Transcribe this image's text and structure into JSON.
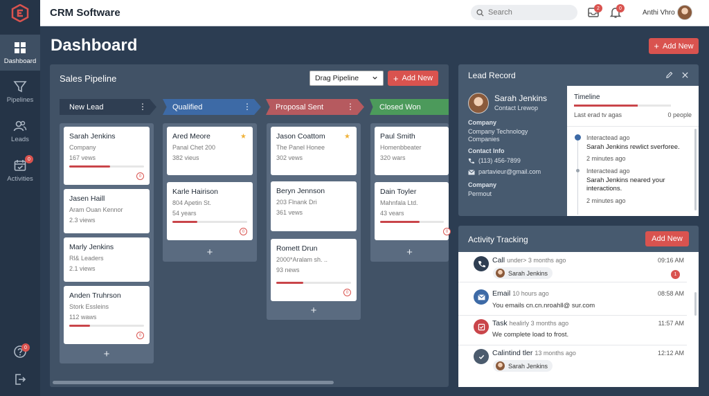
{
  "app": {
    "title": "CRM Software"
  },
  "topbar": {
    "search_placeholder": "Search",
    "messages_badge": "2",
    "notifications_badge": "0",
    "user_name": "Anthi Vhro"
  },
  "sidebar": {
    "items": [
      {
        "label": "Dashboard"
      },
      {
        "label": "Pipelines"
      },
      {
        "label": "Leads"
      },
      {
        "label": "Activities",
        "badge": "0"
      }
    ],
    "help_badge": "0"
  },
  "page": {
    "title": "Dashboard",
    "add_new": "Add New"
  },
  "pipeline": {
    "title": "Sales Pipeline",
    "select_value": "Drag Pipeline",
    "add_new": "Add New",
    "colors": {
      "new_lead": "#2f3e52",
      "qualified": "#3d6aa6",
      "proposal": "#b65a5f",
      "won": "#4c9a5b"
    },
    "stages": [
      {
        "name": "New Lead",
        "cards": [
          {
            "name": "Sarah Jenkins",
            "line2": "Company",
            "line3": "167 vews",
            "progress": 0.55,
            "badge": "0"
          },
          {
            "name": "Jasen Haill",
            "line2": "Aram Ouan Kennor",
            "line3": "2.3 views"
          },
          {
            "name": "Marly Jenkins",
            "line2": "Rl& Leaders",
            "line3": "2.1 views"
          },
          {
            "name": "Anden Truhrson",
            "line2": "Stork Essleins",
            "line3": "112 waws",
            "progress": 0.28,
            "badge": "0"
          }
        ]
      },
      {
        "name": "Qualified",
        "cards": [
          {
            "name": "Ared Meore",
            "line2": "Panal Chet 200",
            "line3": "382 vieus",
            "star": true
          },
          {
            "name": "Karle Hairison",
            "line2": "804 Apetin St.",
            "line3": "54 years",
            "progress": 0.33,
            "badge": "0"
          }
        ]
      },
      {
        "name": "Proposal Sent",
        "cards": [
          {
            "name": "Jason Coattom",
            "line2": "The Panel Honee",
            "line3": "302 vews",
            "star": true
          },
          {
            "name": "Beryn Jennson",
            "line2": "203 Flnank Dri",
            "line3": "361 vews"
          },
          {
            "name": "Romett Drun",
            "line2": "2000*Aralam sh. ..",
            "line3": "93 news",
            "progress": 0.36,
            "badge": "0"
          }
        ]
      },
      {
        "name": "Closed Won",
        "cards": [
          {
            "name": "Paul Smith",
            "line2": "Homenbbeater",
            "line3": "320 wars"
          },
          {
            "name": "Dain Toyler",
            "line2": "Mahnfala Ltd.",
            "line3": "43 vears",
            "progress": 0.62,
            "badge": "0"
          }
        ]
      }
    ]
  },
  "lead_record": {
    "title": "Lead Record",
    "name": "Sarah Jenkins",
    "subtitle": "Contact Lrewop",
    "company_label": "Company",
    "company_value": "Company Technology Companies",
    "contact_label": "Contact Info",
    "phone": "(113) 456-7899",
    "email": "partavieur@gmail.com",
    "company2_label": "Company",
    "company2_value": "Permout",
    "timeline": {
      "title": "Timeline",
      "last_read": "Last erad tv agas",
      "people": "0 people",
      "events": [
        {
          "status": "Interactead ago",
          "text": "Sarah Jenkins rewlict sverforee.",
          "time": "2 minutes ago"
        },
        {
          "status": "Interactead ago",
          "text": "Sarah Jenkins neared your interactions.",
          "time": "2 minutes ago"
        }
      ]
    }
  },
  "activity": {
    "title": "Activity Tracking",
    "add_new": "Add New",
    "items": [
      {
        "title": "Call",
        "sub": "under> 3 months ago",
        "time": "09:16 AM",
        "pill": "Sarah Jenkins",
        "badge": "1",
        "icon": "phone-icon",
        "color": "#2f3e52"
      },
      {
        "title": "Email",
        "sub": "10 hours ago",
        "time": "08:58 AM",
        "detail": "You emails cn.cn.nroahll@ sur.com",
        "icon": "email-icon",
        "color": "#3d6aa6"
      },
      {
        "title": "Task",
        "sub": "healirly  3 months ago",
        "time": "11:57 AM",
        "detail": "We complete load to frost.",
        "icon": "task-icon",
        "color": "#c9454a"
      },
      {
        "title": "Calintind tler",
        "sub": "13 months ago",
        "time": "12:12 AM",
        "pill": "Sarah Jenkins",
        "icon": "check-icon",
        "color": "#4b5b6d"
      }
    ]
  }
}
